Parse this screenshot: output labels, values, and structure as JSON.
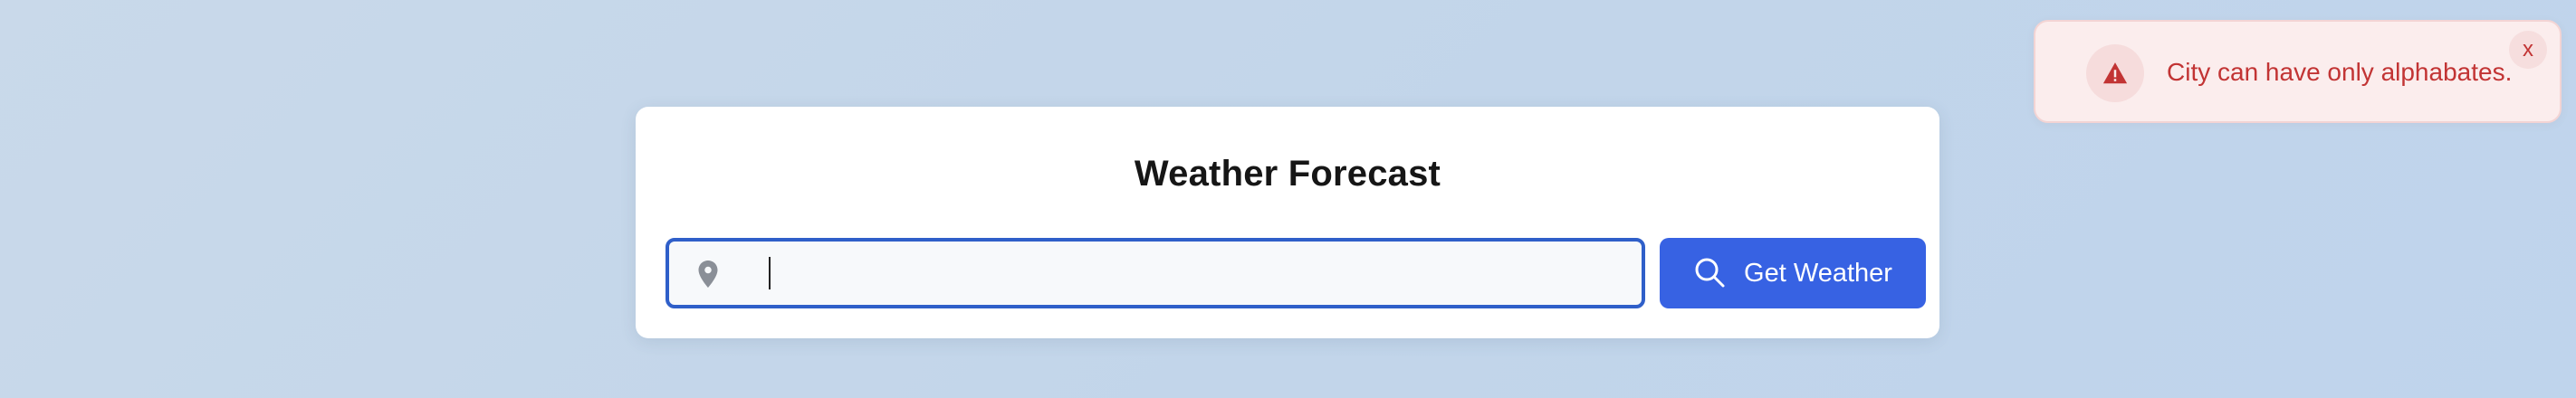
{
  "card": {
    "title": "Weather Forecast"
  },
  "search": {
    "value": "",
    "placeholder": "",
    "location_icon": "map-pin-icon",
    "button_icon": "search-icon",
    "button_label": "Get Weather"
  },
  "toast": {
    "icon": "warning-triangle-icon",
    "message": "City can have only alphabates.",
    "close_label": "x"
  },
  "colors": {
    "accent": "#3762e3",
    "input_focus_border": "#2f5fc9",
    "error_text": "#c23434",
    "toast_background": "#fbeded",
    "page_background": "#c6d8eb"
  }
}
